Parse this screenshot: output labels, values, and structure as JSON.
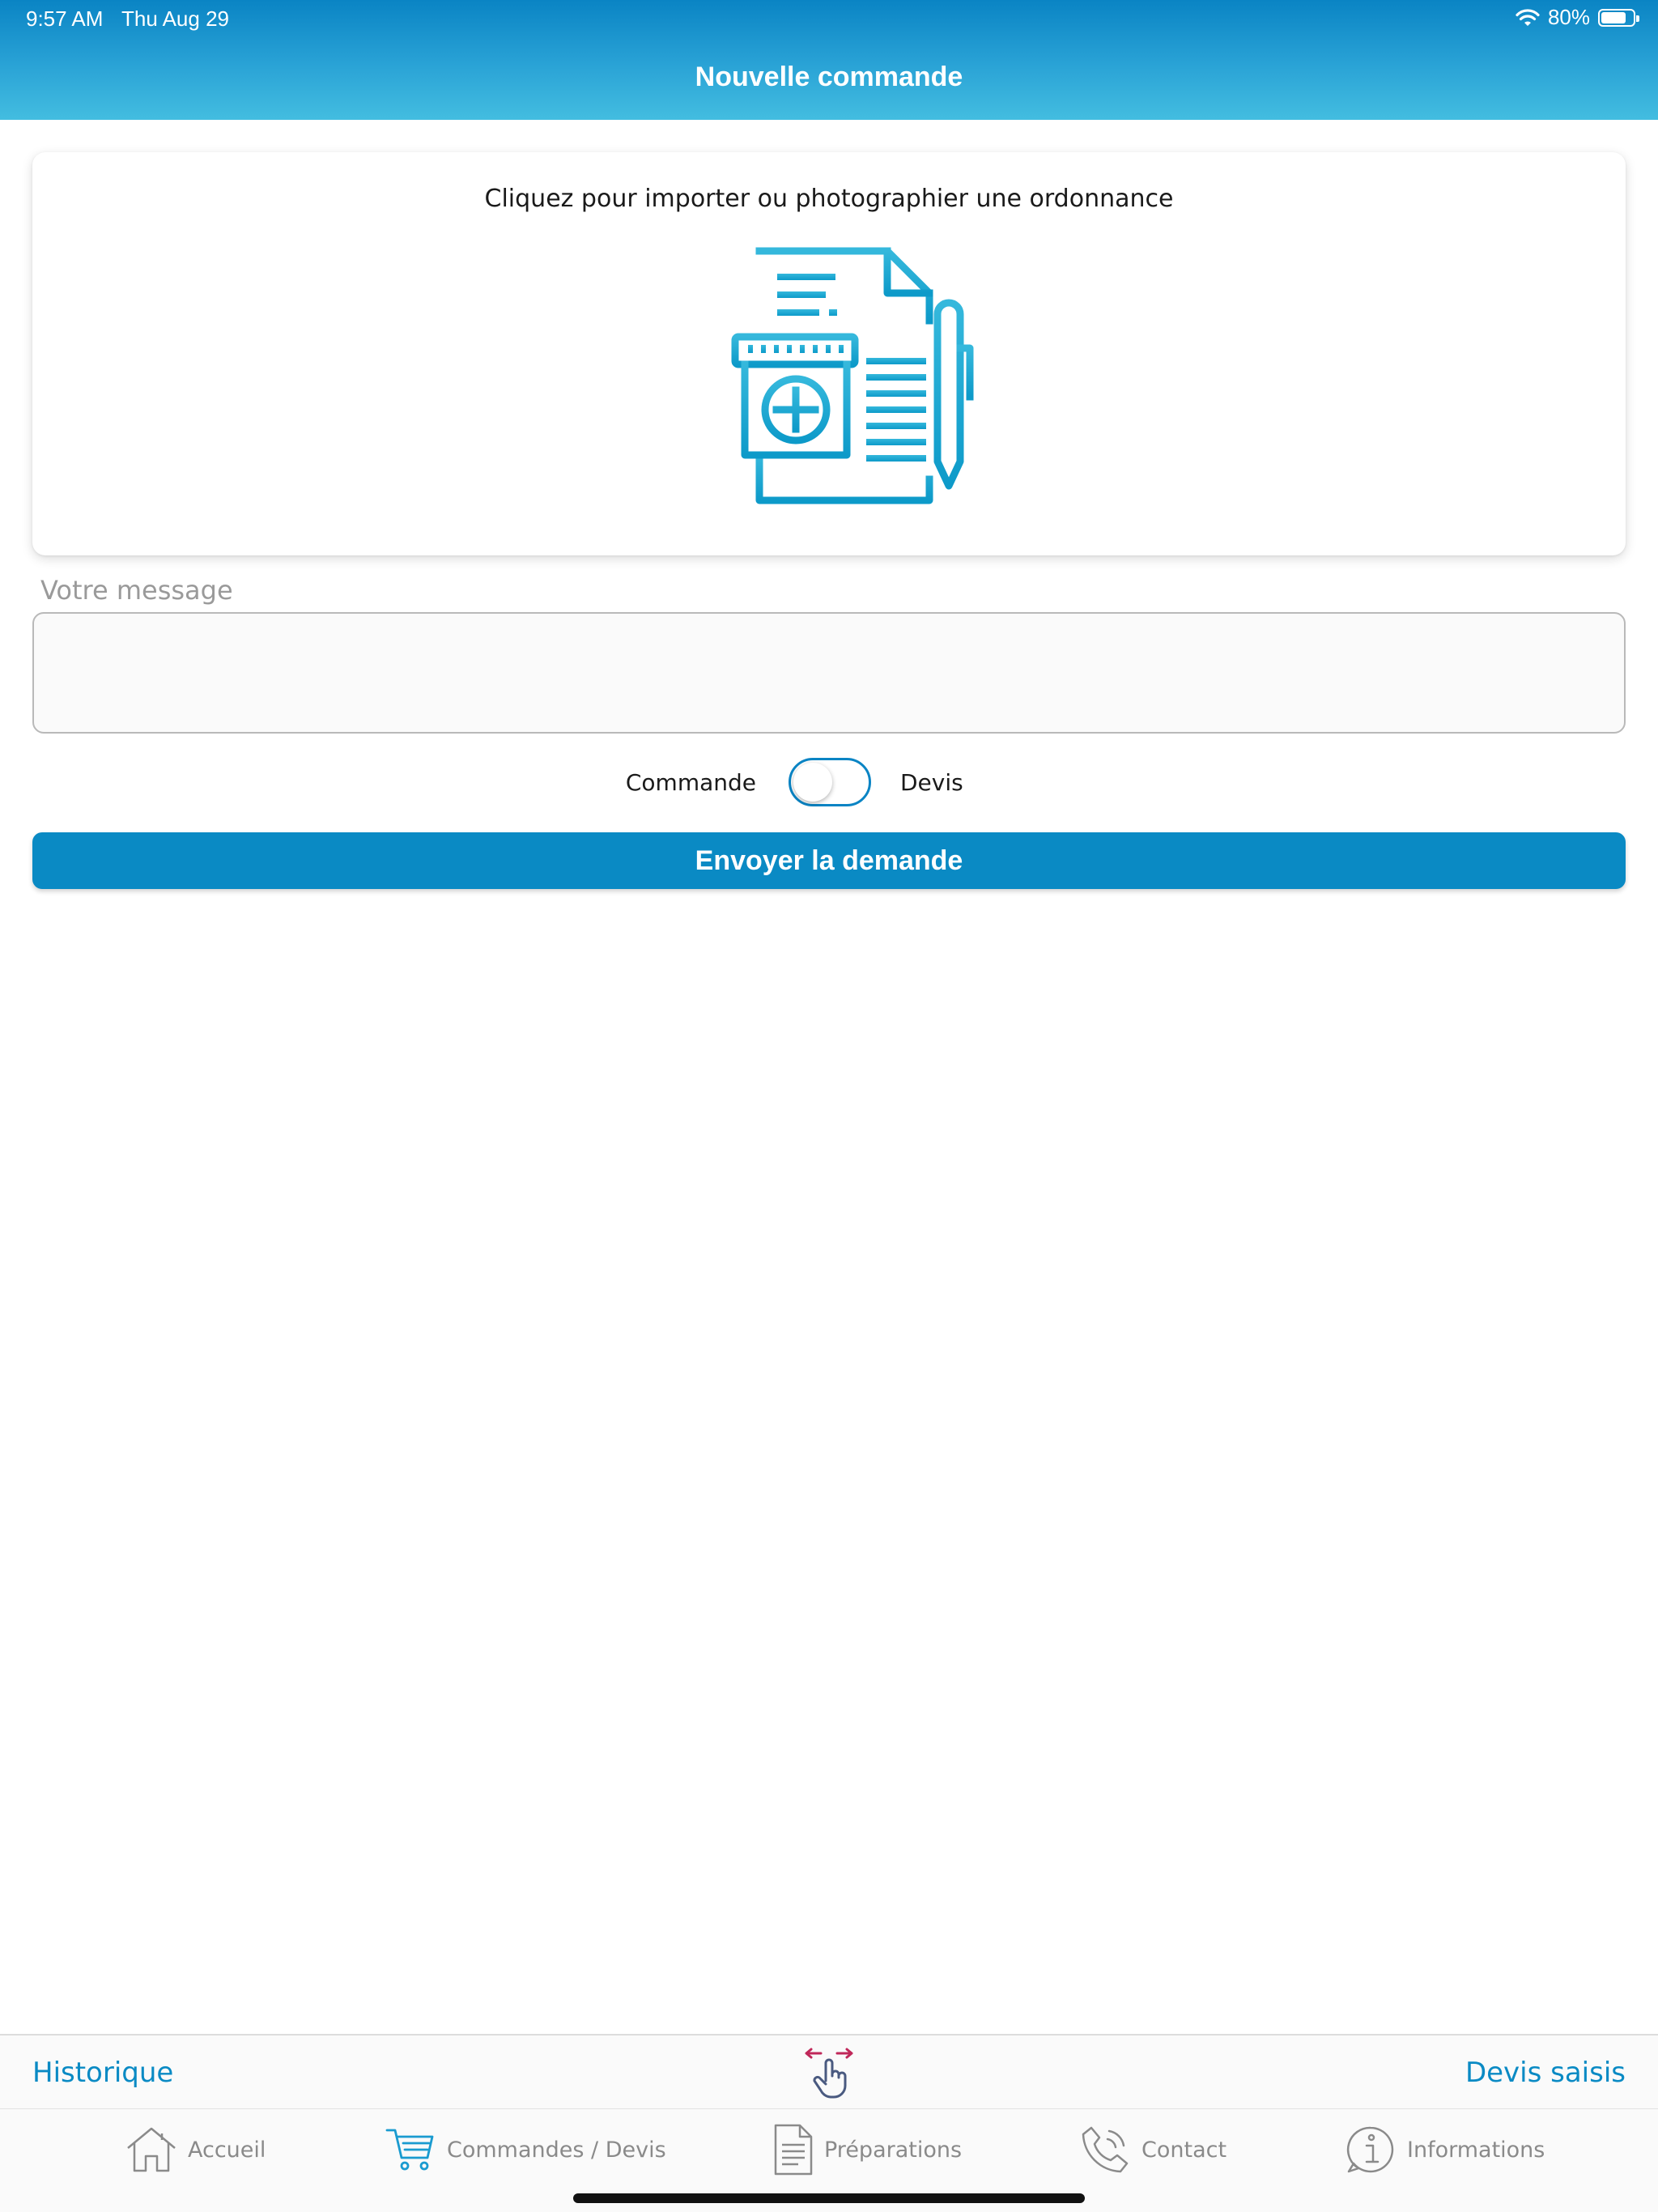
{
  "status_bar": {
    "time": "9:57 AM",
    "date": "Thu Aug 29",
    "battery": "80%",
    "battery_level": 0.8,
    "wifi_icon": "wifi-icon"
  },
  "header": {
    "title": "Nouvelle commande"
  },
  "upload": {
    "instruction": "Cliquez pour importer ou photographier une ordonnance",
    "icon": "prescription-icon"
  },
  "message": {
    "label": "Votre message",
    "value": ""
  },
  "order_type": {
    "left_label": "Commande",
    "right_label": "Devis",
    "selected": "Commande"
  },
  "submit": {
    "label": "Envoyer la demande"
  },
  "sub_bar": {
    "left_link": "Historique",
    "right_link": "Devis saisis",
    "center_icon": "swipe-gesture-icon"
  },
  "tabs": [
    {
      "label": "Accueil",
      "icon": "home-icon",
      "active": false
    },
    {
      "label": "Commandes / Devis",
      "icon": "cart-icon",
      "active": true
    },
    {
      "label": "Préparations",
      "icon": "document-icon",
      "active": false
    },
    {
      "label": "Contact",
      "icon": "phone-icon",
      "active": false
    },
    {
      "label": "Informations",
      "icon": "info-icon",
      "active": false
    }
  ],
  "colors": {
    "primary": "#0a8ac4",
    "header_top": "#0a84c4",
    "header_bottom": "#43bde0",
    "icon_accent": "#29aed6",
    "swipe_accent": "#c0285a"
  }
}
